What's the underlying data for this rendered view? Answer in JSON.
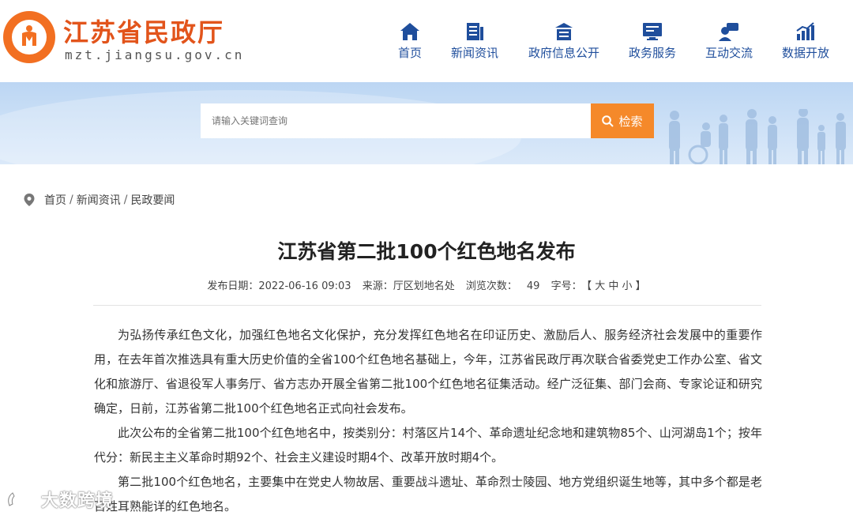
{
  "header": {
    "site_title": "江苏省民政厅",
    "site_domain": "mzt.jiangsu.gov.cn",
    "brand_color": "#e2541b",
    "nav": [
      {
        "label": "首页",
        "icon": "home-icon"
      },
      {
        "label": "新闻资讯",
        "icon": "news-icon"
      },
      {
        "label": "政府信息公开",
        "icon": "government-icon"
      },
      {
        "label": "政务服务",
        "icon": "monitor-icon"
      },
      {
        "label": "互动交流",
        "icon": "chat-icon"
      },
      {
        "label": "数据开放",
        "icon": "chart-icon"
      }
    ],
    "nav_color": "#1f4e9c"
  },
  "search": {
    "placeholder": "请输入关键词查询",
    "button_label": "检索",
    "button_color": "#f5892a"
  },
  "breadcrumb": {
    "items": [
      "首页",
      "新闻资讯",
      "民政要闻"
    ],
    "separator": "/"
  },
  "article": {
    "title": "江苏省第二批100个红色地名发布",
    "meta": {
      "date_label": "发布日期：",
      "date": "2022-06-16 09:03",
      "source_label": "来源：",
      "source": "厅区划地名处",
      "views_label": "浏览次数：",
      "views": "49",
      "font_label": "字号：",
      "font_sizes": "【 大 中 小 】"
    },
    "paragraphs": [
      "为弘扬传承红色文化，加强红色地名文化保护，充分发挥红色地名在印证历史、激励后人、服务经济社会发展中的重要作用，在去年首次推选具有重大历史价值的全省100个红色地名基础上，今年，江苏省民政厅再次联合省委党史工作办公室、省文化和旅游厅、省退役军人事务厅、省方志办开展全省第二批100个红色地名征集活动。经广泛征集、部门会商、专家论证和研究确定，日前，江苏省第二批100个红色地名正式向社会发布。",
      "此次公布的全省第二批100个红色地名中，按类别分：村落区片14个、革命遗址纪念地和建筑物85个、山河湖岛1个；按年代分：新民主主义革命时期92个、社会主义建设时期4个、改革开放时期4个。",
      "第二批100个红色地名，主要集中在党史人物故居、重要战斗遗址、革命烈士陵园、地方党组织诞生地等，其中多个都是老百姓耳熟能详的红色地名。"
    ]
  },
  "watermark": {
    "text": "大数跨境"
  }
}
